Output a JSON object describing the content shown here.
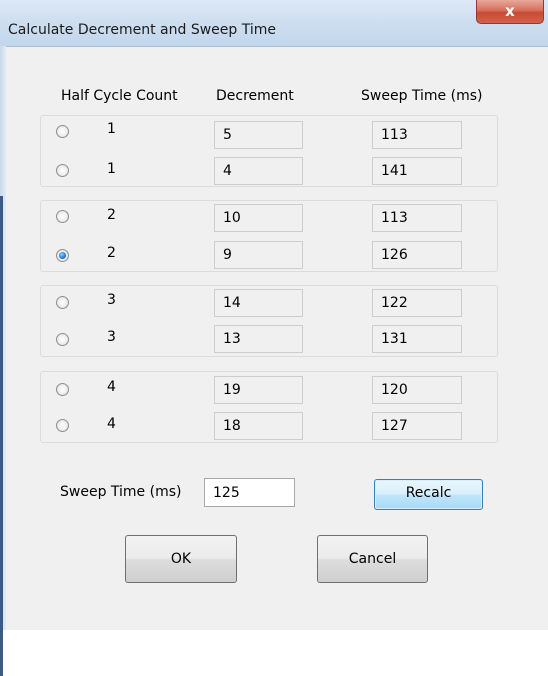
{
  "window": {
    "title": "Calculate Decrement and Sweep Time",
    "close_label": "x"
  },
  "headers": {
    "half_cycle_count": "Half Cycle Count",
    "decrement": "Decrement",
    "sweep_time": "Sweep Time (ms)"
  },
  "rows": [
    {
      "half_cycle_count": "1",
      "decrement": "5",
      "sweep_time": "113",
      "selected": false
    },
    {
      "half_cycle_count": "1",
      "decrement": "4",
      "sweep_time": "141",
      "selected": false
    },
    {
      "half_cycle_count": "2",
      "decrement": "10",
      "sweep_time": "113",
      "selected": false
    },
    {
      "half_cycle_count": "2",
      "decrement": "9",
      "sweep_time": "126",
      "selected": true
    },
    {
      "half_cycle_count": "3",
      "decrement": "14",
      "sweep_time": "122",
      "selected": false
    },
    {
      "half_cycle_count": "3",
      "decrement": "13",
      "sweep_time": "131",
      "selected": false
    },
    {
      "half_cycle_count": "4",
      "decrement": "19",
      "sweep_time": "120",
      "selected": false
    },
    {
      "half_cycle_count": "4",
      "decrement": "18",
      "sweep_time": "127",
      "selected": false
    }
  ],
  "sweep_input": {
    "label": "Sweep Time (ms)",
    "value": "125"
  },
  "buttons": {
    "recalc": "Recalc",
    "ok": "OK",
    "cancel": "Cancel"
  }
}
